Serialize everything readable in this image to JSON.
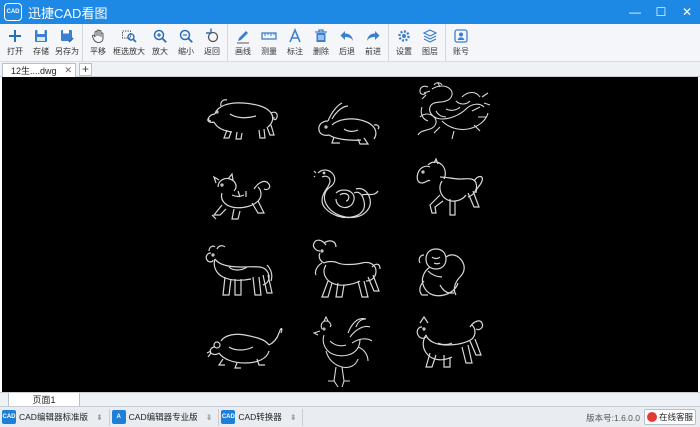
{
  "app": {
    "logo_text": "CAD",
    "title": "迅捷CAD看图"
  },
  "window": {
    "minimize": "—",
    "maximize": "☐",
    "close": "✕"
  },
  "toolbar": {
    "groups": [
      [
        {
          "id": "open",
          "label": "打开",
          "icon": "plus-icon"
        },
        {
          "id": "save",
          "label": "存储",
          "icon": "save-icon"
        },
        {
          "id": "saveas",
          "label": "另存为",
          "icon": "save-as-icon"
        }
      ],
      [
        {
          "id": "pan",
          "label": "平移",
          "icon": "hand-icon"
        },
        {
          "id": "box-zoom",
          "label": "框选放大",
          "icon": "box-zoom-icon"
        },
        {
          "id": "zoom-in",
          "label": "放大",
          "icon": "zoom-in-icon"
        },
        {
          "id": "zoom-out",
          "label": "缩小",
          "icon": "zoom-out-icon"
        },
        {
          "id": "back",
          "label": "返回",
          "icon": "return-icon"
        }
      ],
      [
        {
          "id": "draw-line",
          "label": "画线",
          "icon": "pencil-icon"
        },
        {
          "id": "measure",
          "label": "测量",
          "icon": "ruler-icon"
        },
        {
          "id": "annotate",
          "label": "标注",
          "icon": "text-a-icon"
        },
        {
          "id": "delete",
          "label": "删除",
          "icon": "trash-icon"
        },
        {
          "id": "undo",
          "label": "后退",
          "icon": "undo-arrow-icon"
        },
        {
          "id": "redo",
          "label": "前进",
          "icon": "redo-arrow-icon"
        }
      ],
      [
        {
          "id": "settings",
          "label": "设置",
          "icon": "gear-icon"
        },
        {
          "id": "layers",
          "label": "图层",
          "icon": "layers-icon"
        }
      ],
      [
        {
          "id": "account",
          "label": "账号",
          "icon": "user-icon"
        }
      ]
    ]
  },
  "tabs": {
    "doc_tab": "12生....dwg",
    "close": "✕",
    "add": "+"
  },
  "page_tab": "页面1",
  "statusbar": {
    "items": [
      {
        "label": "CAD编辑器标准版",
        "icon": "CAD"
      },
      {
        "label": "CAD编辑器专业版",
        "icon": "A"
      },
      {
        "label": "CAD转换器",
        "icon": "CAD"
      }
    ],
    "version": "版本号:1.6.0.0",
    "service": "在线客服"
  },
  "colors": {
    "accent": "#1e88e5",
    "canvas": "#000000",
    "drawing_line": "#d8d8d8"
  },
  "drawing": {
    "animals": [
      "rat",
      "ox",
      "tiger",
      "rabbit",
      "dragon",
      "snake",
      "horse",
      "goat",
      "monkey",
      "rooster",
      "dog",
      "pig"
    ]
  }
}
